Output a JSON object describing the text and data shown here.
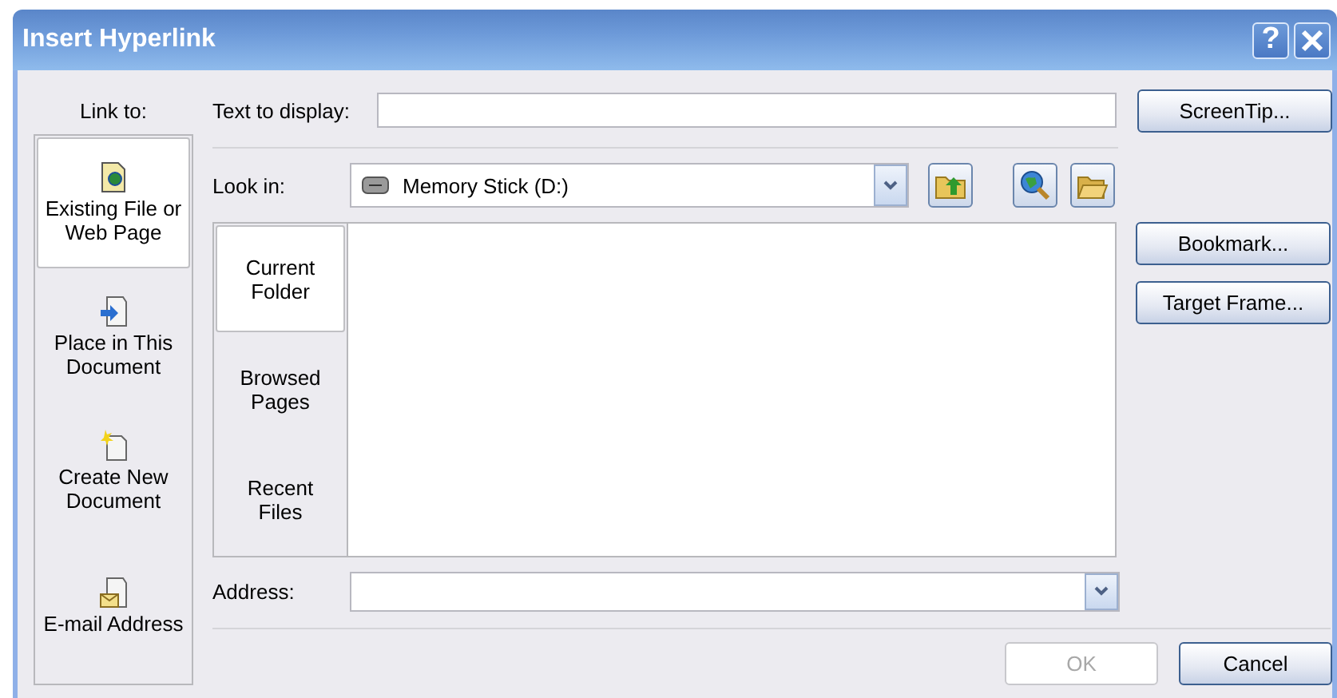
{
  "window": {
    "title": "Insert Hyperlink",
    "help": "?"
  },
  "link_to": {
    "label": "Link to:",
    "items": [
      {
        "label": "Existing File or\nWeb Page",
        "kind": "file",
        "selected": true
      },
      {
        "label": "Place in This\nDocument",
        "kind": "place",
        "selected": false
      },
      {
        "label": "Create New\nDocument",
        "kind": "new",
        "selected": false
      },
      {
        "label": "E-mail Address",
        "kind": "email",
        "selected": false
      }
    ]
  },
  "text_to_display": {
    "label": "Text to display:"
  },
  "look_in": {
    "label": "Look in:",
    "value": "Memory Stick (D:)"
  },
  "tabs": [
    {
      "label": "Current\nFolder",
      "selected": true
    },
    {
      "label": "Browsed\nPages",
      "selected": false
    },
    {
      "label": "Recent\nFiles",
      "selected": false
    }
  ],
  "side_buttons": [
    {
      "label": "ScreenTip..."
    },
    {
      "label": "Bookmark..."
    },
    {
      "label": "Target Frame..."
    }
  ],
  "address": {
    "label": "Address:"
  },
  "buttons": [
    {
      "label": "OK",
      "disabled": true
    },
    {
      "label": "Cancel",
      "disabled": false
    }
  ]
}
